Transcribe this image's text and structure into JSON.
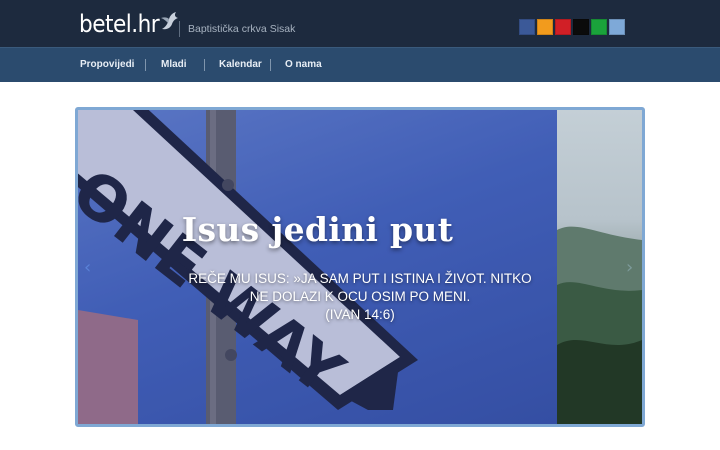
{
  "header": {
    "logo_text": "betel.hr",
    "tagline": "Baptistička crkva Sisak",
    "social_colors": [
      "#3b5998",
      "#f29b1d",
      "#d11f26",
      "#0b0b0b",
      "#1aa33b",
      "#7ea9d8"
    ]
  },
  "nav": {
    "items": [
      {
        "label": "Propovijedi"
      },
      {
        "label": "Mladi"
      },
      {
        "label": "Kalendar"
      },
      {
        "label": "O nama"
      }
    ]
  },
  "slider": {
    "title": "Isus jedini put",
    "text_lines": [
      "REČE MU ISUS: »JA SAM PUT I ISTINA I ŽIVOT. NITKO",
      "NE DOLAZI K OCU OSIM PO MENI.",
      "(IVAN 14:6)"
    ],
    "sign_text": "ONE WAY",
    "prev_arrow": "‹",
    "next_arrow": "›"
  }
}
